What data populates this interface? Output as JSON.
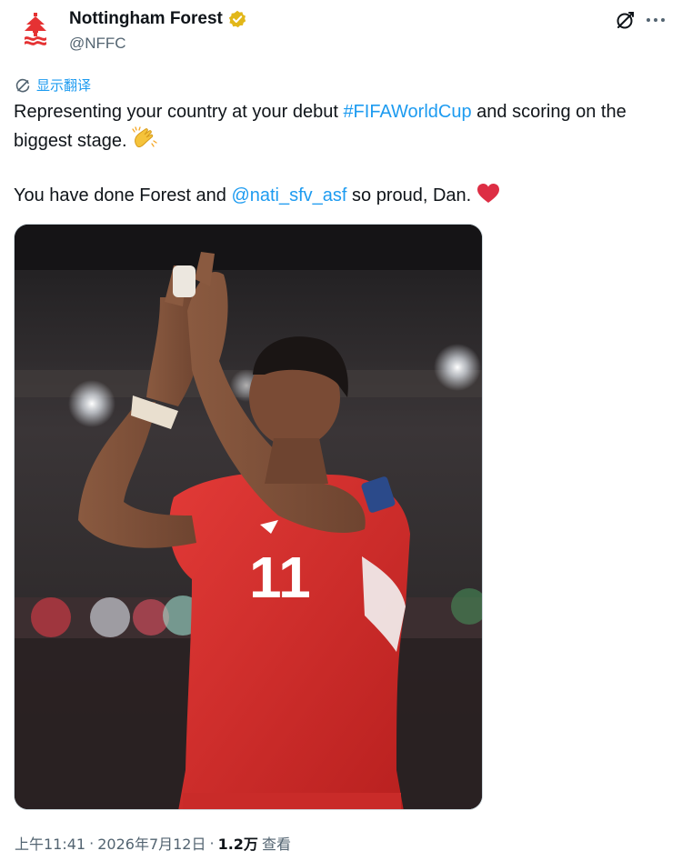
{
  "account": {
    "display_name": "Nottingham Forest",
    "handle": "@NFFC",
    "verified_color": "#e2b719",
    "brand_color": "#e53233"
  },
  "icons": {
    "avatar": "nottingham-forest-crest-icon",
    "verified": "verified-badge-icon",
    "grok": "grok-icon",
    "more": "more-horizontal-icon",
    "translate": "translate-icon",
    "clap": "clapping-hands-emoji",
    "heart": "red-heart-emoji"
  },
  "translate": {
    "label": "显示翻译"
  },
  "tweet": {
    "line1_prefix": "Representing your country at your debut ",
    "hashtag": "#FIFAWorldCup",
    "line1_suffix": " and scoring on the biggest stage. ",
    "line2_prefix": "You have done Forest and ",
    "mention": "@nati_sfv_asf",
    "line2_suffix": " so proud, Dan. "
  },
  "media": {
    "alt": "Player in red number 11 shirt applauding",
    "shirt_number": "11",
    "shirt_color": "#d8312e"
  },
  "meta": {
    "time": "上午11:41",
    "separator": "·",
    "date": "2026年7月12日",
    "views_count": "1.2万",
    "views_label": "查看"
  }
}
